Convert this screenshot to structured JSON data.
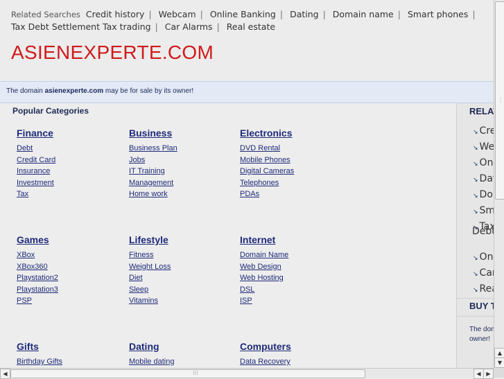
{
  "header": {
    "related_label": "Related Searches",
    "related_links": [
      "Credit history",
      "Webcam",
      "Online Banking",
      "Dating",
      "Domain name",
      "Smart phones",
      "Tax Debt Settlement",
      "Tax trading",
      "Car Alarms",
      "Real estate"
    ],
    "separator": "|",
    "site_title": "ASIENEXPERTE.COM"
  },
  "sale": {
    "prefix": "The domain",
    "domain": "asienexperte.com",
    "suffix": "may be for sale by its owner!"
  },
  "main": {
    "popular_title": "Popular Categories",
    "categories": [
      {
        "title": "Finance",
        "items": [
          "Debt",
          "Credit Card",
          "Insurance",
          "Investment",
          "Tax"
        ]
      },
      {
        "title": "Business",
        "items": [
          "Business Plan",
          "Jobs",
          "IT Training",
          "Management",
          "Home work"
        ]
      },
      {
        "title": "Electronics",
        "items": [
          "DVD Rental",
          "Mobile Phones",
          "Digital Cameras",
          "Telephones",
          "PDAs"
        ]
      },
      {
        "title": "Games",
        "items": [
          "XBox",
          "XBox360",
          "Playstation2",
          "Playstation3",
          "PSP"
        ]
      },
      {
        "title": "Lifestyle",
        "items": [
          "Fitness",
          "Weight Loss",
          "Diet",
          "Sleep",
          "Vitamins"
        ]
      },
      {
        "title": "Internet",
        "items": [
          "Domain Name",
          "Web Design",
          "Web Hosting",
          "DSL",
          "ISP"
        ]
      },
      {
        "title": "Gifts",
        "items": [
          "Birthday Gifts"
        ]
      },
      {
        "title": "Dating",
        "items": [
          "Mobile dating"
        ]
      },
      {
        "title": "Computers",
        "items": [
          "Data Recovery"
        ]
      }
    ]
  },
  "sidebar": {
    "related_heading": "RELAT",
    "items": [
      "Cre",
      "We",
      "Onl",
      "Dat",
      "Dor",
      "Sm",
      "Tax",
      "Onl",
      "Car",
      "Rea"
    ],
    "debt_text": "Debt",
    "buy_heading": "BUY T",
    "domain_note_line1": "The dom",
    "domain_note_line2": "owner!"
  },
  "scrollbars": {
    "up": "▲",
    "down": "▼",
    "left": "◀",
    "right": "▶",
    "grip": "⁞⁞⁞"
  }
}
